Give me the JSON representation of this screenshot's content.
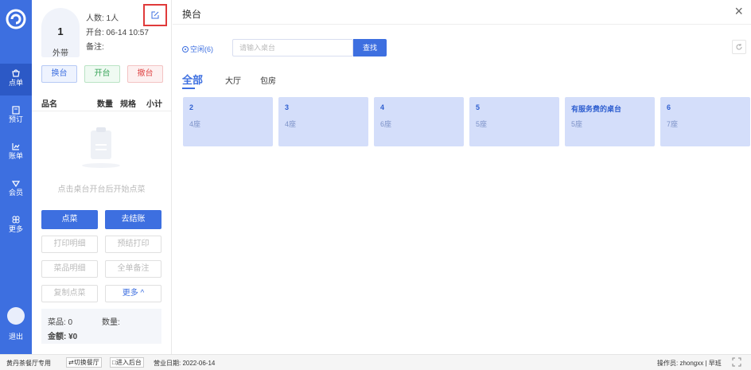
{
  "nav": {
    "items": [
      {
        "label": "点单",
        "icon": "order-icon"
      },
      {
        "label": "预订",
        "icon": "reserve-icon"
      },
      {
        "label": "账单",
        "icon": "bill-icon"
      },
      {
        "label": "会员",
        "icon": "member-icon"
      },
      {
        "label": "更多",
        "icon": "more-icon"
      }
    ],
    "logout": "退出"
  },
  "order": {
    "table_no": "1",
    "table_type": "外带",
    "people": "人数: 1人",
    "open_time": "开台: 06-14 10:57",
    "note": "备注:",
    "actions": {
      "change": "换台",
      "open": "开台",
      "cancel": "撤台"
    },
    "columns": {
      "name": "品名",
      "qty": "数量",
      "spec": "规格",
      "subtotal": "小计"
    },
    "empty_text": "点击桌台开台后开始点菜",
    "btn_order": "点菜",
    "btn_checkout": "去结账",
    "btn_print_detail": "打印明细",
    "btn_pre_print": "预结打印",
    "btn_dish_detail": "菜品明细",
    "btn_all_note": "全单备注",
    "btn_copy": "复制点菜",
    "btn_more": "更多 ^",
    "summary": {
      "dishes": "菜品: 0",
      "qty": "数量:",
      "amount": "金额: ¥0"
    }
  },
  "modal": {
    "title": "换台",
    "close": "×",
    "filter": "空闲(6)",
    "search_placeholder": "请输入桌台",
    "search_btn": "查找",
    "tabs": [
      "全部",
      "大厅",
      "包房"
    ],
    "tables": [
      {
        "no": "2",
        "seats": "4座"
      },
      {
        "no": "3",
        "seats": "4座"
      },
      {
        "no": "4",
        "seats": "6座"
      },
      {
        "no": "5",
        "seats": "5座"
      },
      {
        "no": "有服务费的桌台",
        "seats": "5座"
      },
      {
        "no": "6",
        "seats": "7座"
      }
    ]
  },
  "status": {
    "shop": "黄丹茶餐厅专用",
    "switch": "⇄切换餐厅",
    "backend": "□进入后台",
    "date": "营业日期: 2022-06-14",
    "operator": "操作员: zhongxx | 早班"
  },
  "colors": {
    "primary": "#3d6fe0",
    "tile": "#d4defa",
    "highlight": "#e03a3a"
  }
}
